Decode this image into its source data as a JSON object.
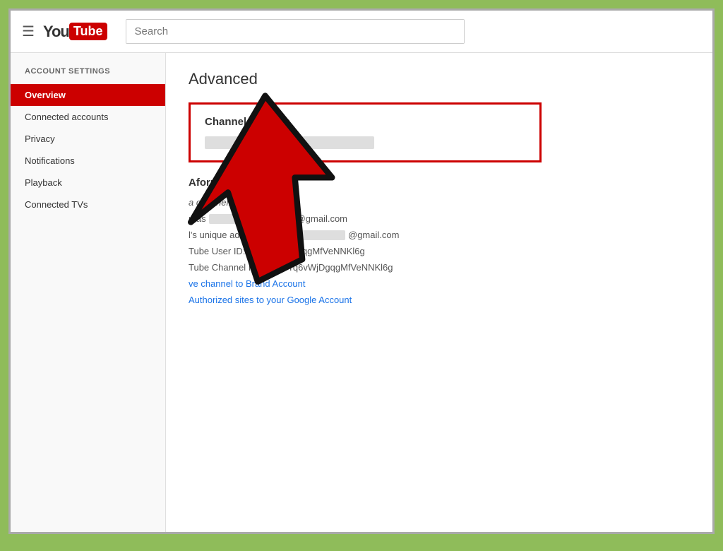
{
  "top_nav": {
    "hamburger_icon": "☰",
    "youtube_logo_text": "You",
    "youtube_logo_box": "Tube",
    "search_placeholder": "Search"
  },
  "sidebar": {
    "section_title": "ACCOUNT SETTINGS",
    "items": [
      {
        "label": "Overview",
        "active": true
      },
      {
        "label": "Connected accounts",
        "active": false
      },
      {
        "label": "Privacy",
        "active": false
      },
      {
        "label": "Notifications",
        "active": false
      },
      {
        "label": "Playback",
        "active": false
      },
      {
        "label": "Connected TVs",
        "active": false
      }
    ]
  },
  "main": {
    "page_title": "Advanced",
    "channel_settings": {
      "title": "Channel settings"
    },
    "account_info": {
      "heading_partial": "formation",
      "line1": "a channel.",
      "line2_prefix": "n as",
      "line2_suffix": "@gmail.com",
      "line3_prefix": "l's unique address:",
      "line3_suffix": "@gmail.com",
      "line4": "Tube User ID: OcYq6vWjDgqgMfVeNNKl6g",
      "line5": "Tube Channel ID: UCOcYq6vWjDgqgMfVeNNKl6g",
      "link1": "ve channel to Brand Account",
      "link2": "Authorized sites to your Google Account"
    }
  }
}
